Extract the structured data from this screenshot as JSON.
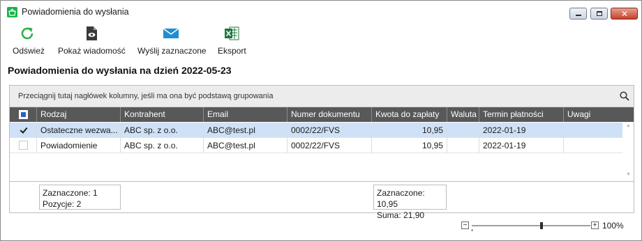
{
  "window": {
    "title": "Powiadomienia do wysłania"
  },
  "toolbar": {
    "buttons": [
      {
        "label": "Odśwież",
        "icon": "refresh-icon",
        "color": "#2db34a"
      },
      {
        "label": "Pokaż wiadomość",
        "icon": "document-eye-icon",
        "color": "#3a3a3a"
      },
      {
        "label": "Wyślij zaznaczone",
        "icon": "envelope-icon",
        "color": "#1f8fd4"
      },
      {
        "label": "Eksport",
        "icon": "excel-icon",
        "color": "#1f7a3c"
      }
    ]
  },
  "heading": "Powiadomienia do wysłania na dzień 2022-05-23",
  "grid": {
    "group_panel_text": "Przeciągnij tutaj nagłówek kolumny, jeśli ma ona być podstawą grupowania",
    "columns": [
      "Rodzaj",
      "Kontrahent",
      "Email",
      "Numer dokumentu",
      "Kwota do zapłaty",
      "Waluta",
      "Termin płatności",
      "Uwagi"
    ],
    "rows": [
      {
        "selected": true,
        "checked": true,
        "cells": [
          "Ostateczne wezwa...",
          "ABC sp. z o.o.",
          "ABC@test.pl",
          "0002/22/FVS",
          "10,95",
          "",
          "2022-01-19",
          ""
        ]
      },
      {
        "selected": false,
        "checked": false,
        "cells": [
          "Powiadomienie",
          "ABC sp. z o.o.",
          "ABC@test.pl",
          "0002/22/FVS",
          "10,95",
          "",
          "2022-01-19",
          ""
        ]
      }
    ],
    "footer": {
      "left_line1": "Zaznaczone: 1",
      "left_line2": "Pozycje: 2",
      "right_line1": "Zaznaczone: 10,95",
      "right_line2": "Suma: 21,90"
    }
  },
  "zoom": {
    "minus": "−",
    "plus": "+",
    "level": "100%"
  },
  "colors": {
    "header_bg": "#585858",
    "selected_row": "#cfe1f6",
    "group_panel": "#ececec"
  }
}
